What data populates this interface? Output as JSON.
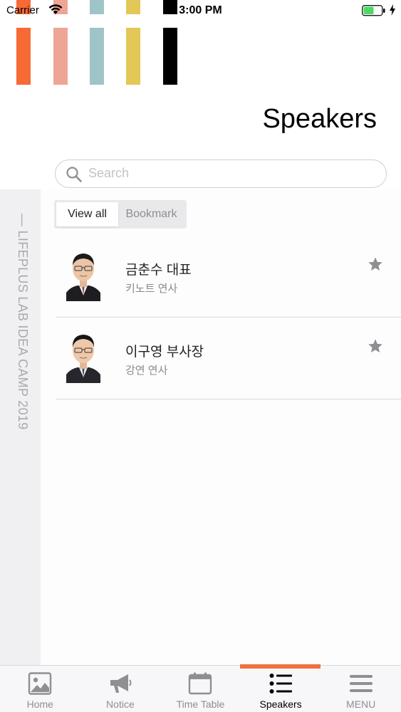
{
  "status_bar": {
    "carrier": "Carrier",
    "time": "3:00 PM"
  },
  "stripes": {
    "colors": [
      "#f56a35",
      "#eea595",
      "#9fc4c8",
      "#e3c858",
      "#000000"
    ]
  },
  "page": {
    "title": "Speakers"
  },
  "search": {
    "placeholder": "Search",
    "value": ""
  },
  "side_label": "— LIFEPLUS LAB IDEA CAMP 2019",
  "filter": {
    "tabs": [
      {
        "label": "View all",
        "selected": true
      },
      {
        "label": "Bookmark",
        "selected": false
      }
    ]
  },
  "speakers": [
    {
      "name": "금춘수 대표",
      "role": "키노트 연사",
      "bookmarked": false
    },
    {
      "name": "이구영 부사장",
      "role": "강연 연사",
      "bookmarked": false
    }
  ],
  "tab_bar": {
    "items": [
      {
        "label": "Home",
        "icon": "image-icon"
      },
      {
        "label": "Notice",
        "icon": "megaphone-icon"
      },
      {
        "label": "Time Table",
        "icon": "calendar-icon"
      },
      {
        "label": "Speakers",
        "icon": "list-icon"
      },
      {
        "label": "MENU",
        "icon": "hamburger-icon"
      }
    ],
    "active": "Speakers",
    "accent_color": "#f26f3a"
  }
}
